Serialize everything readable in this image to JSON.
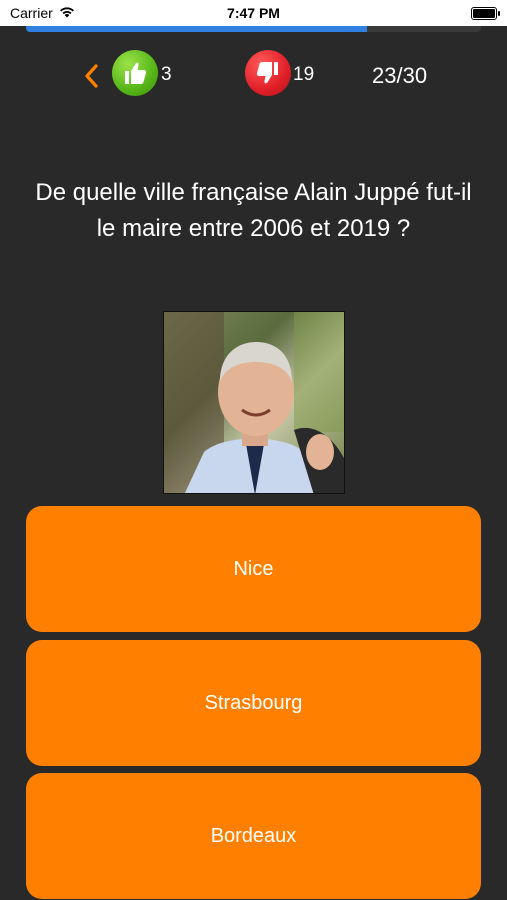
{
  "status": {
    "carrier": "Carrier",
    "time": "7:47 PM"
  },
  "quiz": {
    "progress": 0.75,
    "likes": "3",
    "dislikes": "19",
    "question_number": "23/30",
    "question": "De quelle ville française Alain Juppé fut-il le maire entre 2006 et 2019 ?",
    "answers": [
      "Nice",
      "Strasbourg",
      "Bordeaux"
    ]
  },
  "colors": {
    "background": "#292929",
    "accent": "#ff8000",
    "progress": "#2f80e0",
    "like": "#56b518",
    "dislike": "#e01f27"
  },
  "icons": {
    "back": "chevron-left-icon",
    "like": "thumbs-up-icon",
    "dislike": "thumbs-down-icon"
  }
}
